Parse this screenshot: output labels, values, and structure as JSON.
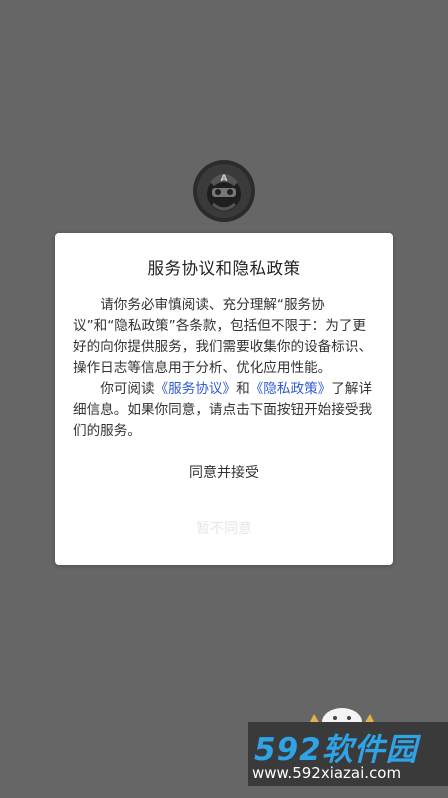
{
  "dialog": {
    "title": "服务协议和隐私政策",
    "para1": "请你务必审慎阅读、充分理解“服务协议”和“隐私政策”各条款，包括但不限于：为了更好的向你提供服务，我们需要收集你的设备标识、操作日志等信息用于分析、优化应用性能。",
    "para2_prefix": "你可阅读",
    "link_service": "《服务协议》",
    "para2_and": "和",
    "link_privacy": "《隐私政策》",
    "para2_suffix": "了解详细信息。如果你同意，请点击下面按钮开始接受我们的服务。",
    "accept_label": "同意并接受",
    "reject_label": "暂不同意"
  },
  "app_logo": {
    "icon": "app-logo-icon",
    "letter": "A"
  },
  "watermark": {
    "logo_text": "592软件园",
    "url": "www.592xiazai.com"
  },
  "colors": {
    "overlay_bg": "#666666",
    "dialog_bg": "#ffffff",
    "link": "#2f5bd3",
    "reject_text": "#e6e6e6",
    "watermark_blue": "#2ea4e6"
  }
}
